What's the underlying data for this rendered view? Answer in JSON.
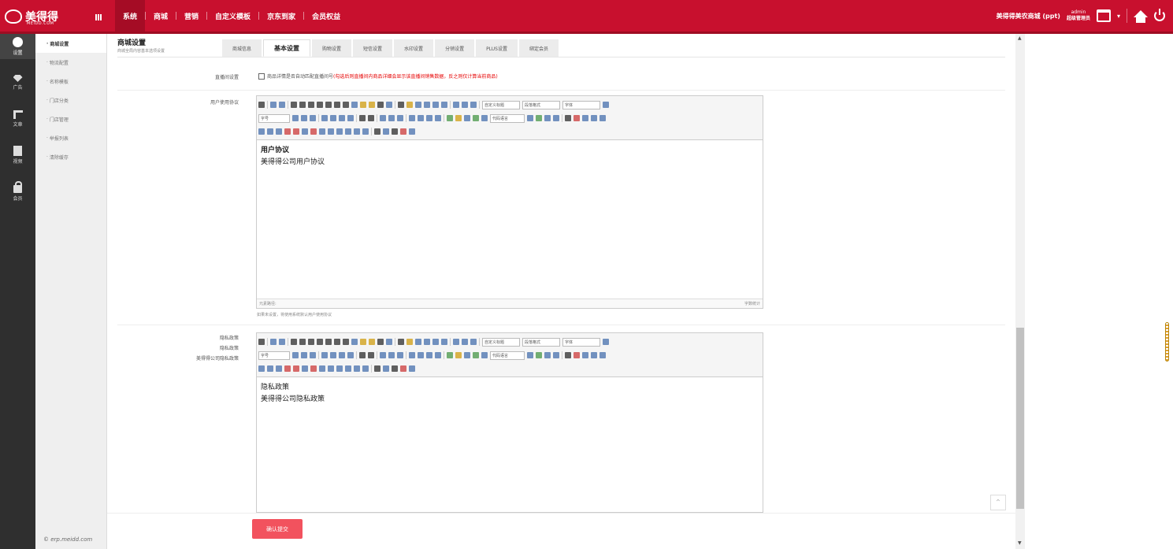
{
  "header": {
    "logo_text": "美得得",
    "logo_sub": "MEIDD.COM",
    "nav": [
      "系统",
      "商城",
      "营销",
      "自定义模板",
      "京东到家",
      "会员权益"
    ],
    "store_name": "美得得美农商城 (ppt)",
    "admin_user": "admin",
    "admin_role": "超级管理员"
  },
  "sidebar": {
    "items": [
      {
        "label": "设置",
        "icon": "gear-icon"
      },
      {
        "label": "广告",
        "icon": "diamond-icon"
      },
      {
        "label": "文章",
        "icon": "org-chart-icon"
      },
      {
        "label": "视频",
        "icon": "document-icon"
      },
      {
        "label": "会员",
        "icon": "lock-icon"
      }
    ]
  },
  "subnav": {
    "items": [
      "商城设置",
      "物流配置",
      "名称模板",
      "门店分类",
      "门店管理",
      "举报列表",
      "清除缓存"
    ],
    "footer": "© erp.meidd.com"
  },
  "page": {
    "title": "商城设置",
    "subtitle": "商城全局内容基本选项设置",
    "tabs": [
      "商城信息",
      "基本设置",
      "购物设置",
      "短信设置",
      "水印设置",
      "分销设置",
      "PLUS设置",
      "绑定会员"
    ]
  },
  "form": {
    "search_label": "直播间设置",
    "search_checkbox": "商品详情是否自动匹配直播间号",
    "search_note": "(勾选后则直播间内商品详细会显示该直播间销售数据，反之则仅计算当前商品)",
    "agreement_label": "用户使用协议",
    "agreement_title": "用户协议",
    "agreement_body": "美得得公司用户协议",
    "editor_path": "元素路径:",
    "editor_count": "字数统计",
    "agreement_hint": "如果未设置，将使用系统默认用户使用协议",
    "privacy_label_1": "隐私政策",
    "privacy_label_2": "隐私政策",
    "privacy_label_3": "美得得公司隐私政策",
    "privacy_title": "隐私政策",
    "privacy_body": "美得得公司隐私政策",
    "toolbar": {
      "paragraph": "自定义标题",
      "format": "段落格式",
      "font": "字体",
      "size": "字号",
      "code": "代码语言"
    },
    "submit_label": "确认提交"
  }
}
